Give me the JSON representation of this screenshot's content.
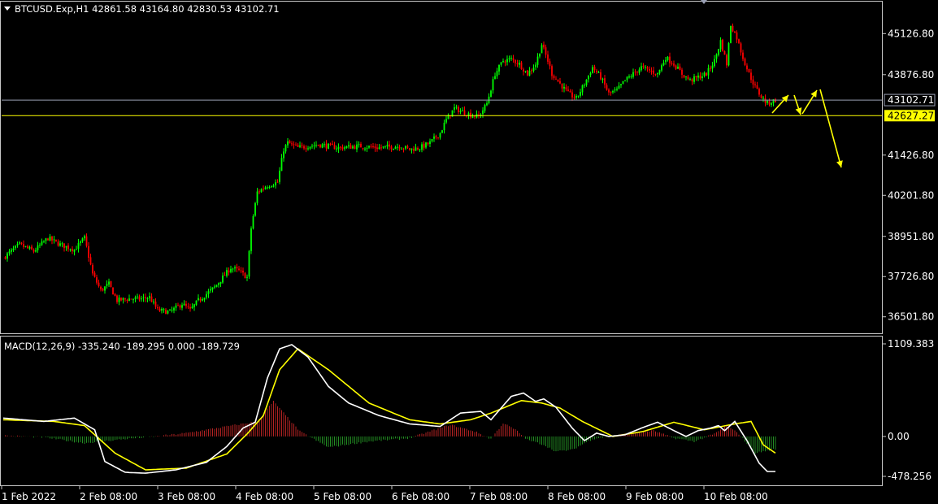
{
  "header": {
    "symbol_line": "BTCUSD.Exp,H1  42861.58 43164.80 42830.53 43102.71"
  },
  "macd_header": {
    "text": "MACD(12,26,9) -335.240 -189.295 0.000 -189.729"
  },
  "colors": {
    "bull": "#00ff00",
    "bear": "#ff0000",
    "signal": "#ffff00",
    "macd_line": "#ffffff",
    "price_line": "#9aa0b4",
    "level_line": "#ffff00"
  },
  "chart_data": [
    {
      "type": "candlestick",
      "title": "BTCUSD.Exp,H1",
      "ohlc_last": {
        "open": 42861.58,
        "high": 43164.8,
        "low": 42830.53,
        "close": 43102.71
      },
      "ylim": [
        36000,
        46100
      ],
      "y_ticks": [
        {
          "value": 45126.8,
          "label": "45126.80"
        },
        {
          "value": 43876.8,
          "label": "43876.80"
        },
        {
          "value": 41426.8,
          "label": "41426.80"
        },
        {
          "value": 40201.8,
          "label": "40201.80"
        },
        {
          "value": 38951.8,
          "label": "38951.80"
        },
        {
          "value": 37726.8,
          "label": "37726.80"
        },
        {
          "value": 36501.8,
          "label": "36501.80"
        }
      ],
      "current_price": {
        "value": 43102.71,
        "label": "43102.71"
      },
      "horizontal_level": {
        "value": 42627.27,
        "label": "42627.27"
      },
      "x_ticks": [
        "1 Feb 2022",
        "2 Feb 08:00",
        "3 Feb 08:00",
        "4 Feb 08:00",
        "5 Feb 08:00",
        "6 Feb 08:00",
        "7 Feb 08:00",
        "8 Feb 08:00",
        "9 Feb 08:00",
        "10 Feb 08:00"
      ],
      "close_path": [
        [
          0,
          38300
        ],
        [
          8,
          38700
        ],
        [
          15,
          38500
        ],
        [
          22,
          38900
        ],
        [
          28,
          38700
        ],
        [
          35,
          38550
        ],
        [
          40,
          38900
        ],
        [
          44,
          37800
        ],
        [
          48,
          37300
        ],
        [
          52,
          37500
        ],
        [
          56,
          37000
        ],
        [
          62,
          37050
        ],
        [
          68,
          37050
        ],
        [
          72,
          37100
        ],
        [
          76,
          36700
        ],
        [
          82,
          36650
        ],
        [
          88,
          36900
        ],
        [
          92,
          36700
        ],
        [
          96,
          37000
        ],
        [
          100,
          37200
        ],
        [
          104,
          37400
        ],
        [
          108,
          37700
        ],
        [
          112,
          38000
        ],
        [
          116,
          37900
        ],
        [
          120,
          37700
        ],
        [
          122,
          39200
        ],
        [
          125,
          40300
        ],
        [
          130,
          40500
        ],
        [
          135,
          40600
        ],
        [
          138,
          41600
        ],
        [
          140,
          41800
        ],
        [
          145,
          41650
        ],
        [
          155,
          41750
        ],
        [
          165,
          41650
        ],
        [
          175,
          41700
        ],
        [
          185,
          41650
        ],
        [
          195,
          41700
        ],
        [
          200,
          41600
        ],
        [
          205,
          41650
        ],
        [
          210,
          41800
        ],
        [
          215,
          42100
        ],
        [
          218,
          42500
        ],
        [
          222,
          42850
        ],
        [
          226,
          42750
        ],
        [
          230,
          42650
        ],
        [
          234,
          42600
        ],
        [
          238,
          43000
        ],
        [
          242,
          43900
        ],
        [
          246,
          44300
        ],
        [
          250,
          44350
        ],
        [
          254,
          44200
        ],
        [
          258,
          43900
        ],
        [
          262,
          44200
        ],
        [
          265,
          44800
        ],
        [
          268,
          44300
        ],
        [
          270,
          43900
        ],
        [
          274,
          43600
        ],
        [
          278,
          43300
        ],
        [
          282,
          43150
        ],
        [
          286,
          43600
        ],
        [
          290,
          44100
        ],
        [
          294,
          43800
        ],
        [
          298,
          43300
        ],
        [
          302,
          43400
        ],
        [
          306,
          43700
        ],
        [
          310,
          43900
        ],
        [
          314,
          44100
        ],
        [
          318,
          44000
        ],
        [
          322,
          43900
        ],
        [
          326,
          44400
        ],
        [
          330,
          44200
        ],
        [
          334,
          43900
        ],
        [
          338,
          43700
        ],
        [
          342,
          43800
        ],
        [
          346,
          43900
        ],
        [
          350,
          44300
        ],
        [
          353,
          44900
        ],
        [
          356,
          44200
        ],
        [
          358,
          45400
        ],
        [
          361,
          45000
        ],
        [
          364,
          44400
        ],
        [
          367,
          43900
        ],
        [
          370,
          43500
        ],
        [
          373,
          43200
        ],
        [
          376,
          43000
        ],
        [
          380,
          43100
        ]
      ],
      "forecast_arrows": [
        [
          [
            950,
            139
          ],
          [
            970,
            117
          ]
        ],
        [
          [
            977,
            117
          ],
          [
            985,
            141
          ]
        ],
        [
          [
            987,
            140
          ],
          [
            1005,
            111
          ]
        ],
        [
          [
            1009,
            110
          ],
          [
            1035,
            206
          ]
        ]
      ]
    },
    {
      "type": "line",
      "title": "MACD(12,26,9)",
      "ylim": [
        -478.256,
        1109.383
      ],
      "y_ticks": [
        {
          "value": 1109.383,
          "label": "1109.383"
        },
        {
          "value": 0.0,
          "label": "0.00"
        },
        {
          "value": -478.256,
          "label": "-478.256"
        }
      ],
      "series": [
        {
          "name": "MACD",
          "points": [
            [
              0,
              220
            ],
            [
              20,
              180
            ],
            [
              35,
              220
            ],
            [
              45,
              80
            ],
            [
              50,
              -300
            ],
            [
              60,
              -430
            ],
            [
              70,
              -440
            ],
            [
              85,
              -400
            ],
            [
              100,
              -310
            ],
            [
              110,
              -120
            ],
            [
              118,
              100
            ],
            [
              124,
              170
            ],
            [
              130,
              700
            ],
            [
              136,
              1050
            ],
            [
              142,
              1100
            ],
            [
              150,
              950
            ],
            [
              160,
              600
            ],
            [
              170,
              400
            ],
            [
              185,
              250
            ],
            [
              200,
              150
            ],
            [
              215,
              120
            ],
            [
              225,
              280
            ],
            [
              235,
              300
            ],
            [
              240,
              200
            ],
            [
              250,
              480
            ],
            [
              256,
              520
            ],
            [
              262,
              420
            ],
            [
              266,
              450
            ],
            [
              272,
              350
            ],
            [
              280,
              100
            ],
            [
              286,
              -50
            ],
            [
              292,
              40
            ],
            [
              298,
              0
            ],
            [
              306,
              20
            ],
            [
              314,
              100
            ],
            [
              322,
              170
            ],
            [
              330,
              70
            ],
            [
              336,
              0
            ],
            [
              342,
              70
            ],
            [
              348,
              100
            ],
            [
              352,
              130
            ],
            [
              355,
              70
            ],
            [
              360,
              180
            ],
            [
              366,
              -50
            ],
            [
              372,
              -320
            ],
            [
              376,
              -420
            ],
            [
              380,
              -420
            ]
          ]
        },
        {
          "name": "Signal",
          "points": [
            [
              0,
              200
            ],
            [
              25,
              180
            ],
            [
              40,
              130
            ],
            [
              55,
              -200
            ],
            [
              70,
              -400
            ],
            [
              90,
              -380
            ],
            [
              110,
              -210
            ],
            [
              120,
              30
            ],
            [
              128,
              250
            ],
            [
              136,
              800
            ],
            [
              145,
              1050
            ],
            [
              160,
              800
            ],
            [
              180,
              400
            ],
            [
              200,
              200
            ],
            [
              215,
              150
            ],
            [
              230,
              200
            ],
            [
              240,
              280
            ],
            [
              255,
              430
            ],
            [
              265,
              400
            ],
            [
              274,
              340
            ],
            [
              285,
              180
            ],
            [
              300,
              0
            ],
            [
              315,
              60
            ],
            [
              330,
              170
            ],
            [
              345,
              80
            ],
            [
              360,
              150
            ],
            [
              368,
              180
            ],
            [
              374,
              -100
            ],
            [
              380,
              -200
            ]
          ]
        },
        {
          "name": "Histogram",
          "points": [
            [
              0,
              10
            ],
            [
              20,
              -10
            ],
            [
              40,
              -80
            ],
            [
              60,
              -30
            ],
            [
              75,
              0
            ],
            [
              90,
              40
            ],
            [
              110,
              120
            ],
            [
              125,
              180
            ],
            [
              133,
              420
            ],
            [
              138,
              280
            ],
            [
              146,
              60
            ],
            [
              160,
              -130
            ],
            [
              180,
              -60
            ],
            [
              200,
              -20
            ],
            [
              220,
              140
            ],
            [
              232,
              60
            ],
            [
              240,
              -30
            ],
            [
              246,
              160
            ],
            [
              252,
              80
            ],
            [
              258,
              -40
            ],
            [
              266,
              -100
            ],
            [
              272,
              -180
            ],
            [
              280,
              -160
            ],
            [
              290,
              -30
            ],
            [
              300,
              10
            ],
            [
              310,
              40
            ],
            [
              320,
              70
            ],
            [
              330,
              -20
            ],
            [
              340,
              -60
            ],
            [
              350,
              30
            ],
            [
              356,
              130
            ],
            [
              362,
              30
            ],
            [
              370,
              -200
            ],
            [
              380,
              -150
            ]
          ]
        }
      ]
    }
  ]
}
